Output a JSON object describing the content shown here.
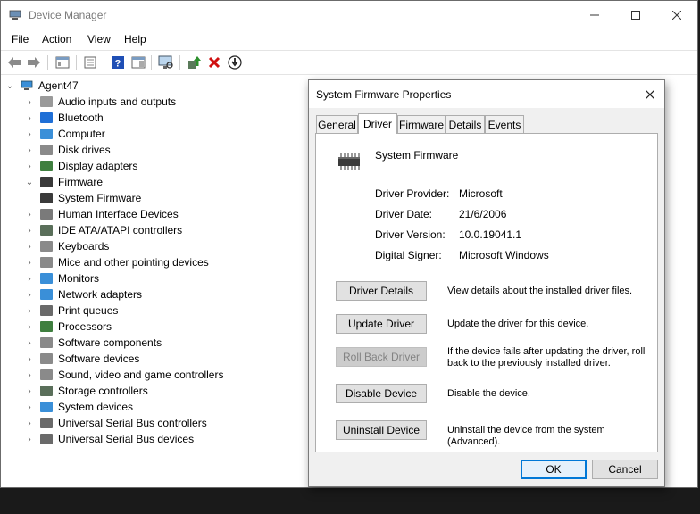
{
  "window": {
    "title": "Device Manager"
  },
  "menubar": {
    "items": [
      "File",
      "Action",
      "View",
      "Help"
    ]
  },
  "toolbar": {
    "icons": [
      "back-arrow-icon",
      "forward-arrow-icon",
      "show-hide-tree-icon",
      "properties-icon",
      "help-icon",
      "action-pane-icon",
      "scan-hardware-icon",
      "update-driver-icon",
      "uninstall-icon",
      "disable-device-icon"
    ]
  },
  "tree": {
    "root": "Agent47",
    "nodes": [
      {
        "label": "Audio inputs and outputs",
        "icon": "speaker-icon",
        "color": "#9a9a9a",
        "expanded": false
      },
      {
        "label": "Bluetooth",
        "icon": "bluetooth-icon",
        "color": "#1f6fd6",
        "expanded": false
      },
      {
        "label": "Computer",
        "icon": "computer-icon",
        "color": "#3a8fd8",
        "expanded": false
      },
      {
        "label": "Disk drives",
        "icon": "disk-drive-icon",
        "color": "#8a8a8a",
        "expanded": false
      },
      {
        "label": "Display adapters",
        "icon": "display-adapter-icon",
        "color": "#3f7f3f",
        "expanded": false
      },
      {
        "label": "Firmware",
        "icon": "firmware-chip-icon",
        "color": "#3a3a3a",
        "expanded": true
      },
      {
        "label": "System Firmware",
        "icon": "firmware-chip-icon",
        "color": "#3a3a3a",
        "child": true
      },
      {
        "label": "Human Interface Devices",
        "icon": "hid-icon",
        "color": "#7a7a7a",
        "expanded": false
      },
      {
        "label": "IDE ATA/ATAPI controllers",
        "icon": "ide-controller-icon",
        "color": "#5a6f5a",
        "expanded": false
      },
      {
        "label": "Keyboards",
        "icon": "keyboard-icon",
        "color": "#8a8a8a",
        "expanded": false
      },
      {
        "label": "Mice and other pointing devices",
        "icon": "mouse-icon",
        "color": "#8a8a8a",
        "expanded": false
      },
      {
        "label": "Monitors",
        "icon": "monitor-icon",
        "color": "#3a8fd8",
        "expanded": false
      },
      {
        "label": "Network adapters",
        "icon": "network-adapter-icon",
        "color": "#3a8fd8",
        "expanded": false
      },
      {
        "label": "Print queues",
        "icon": "printer-icon",
        "color": "#6a6a6a",
        "expanded": false
      },
      {
        "label": "Processors",
        "icon": "processor-icon",
        "color": "#3f7f3f",
        "expanded": false
      },
      {
        "label": "Software components",
        "icon": "software-component-icon",
        "color": "#8a8a8a",
        "expanded": false
      },
      {
        "label": "Software devices",
        "icon": "software-device-icon",
        "color": "#8a8a8a",
        "expanded": false
      },
      {
        "label": "Sound, video and game controllers",
        "icon": "sound-icon",
        "color": "#8a8a8a",
        "expanded": false
      },
      {
        "label": "Storage controllers",
        "icon": "storage-controller-icon",
        "color": "#5a6f5a",
        "expanded": false
      },
      {
        "label": "System devices",
        "icon": "system-device-icon",
        "color": "#3a8fd8",
        "expanded": false
      },
      {
        "label": "Universal Serial Bus controllers",
        "icon": "usb-icon",
        "color": "#6a6a6a",
        "expanded": false
      },
      {
        "label": "Universal Serial Bus devices",
        "icon": "usb-icon",
        "color": "#6a6a6a",
        "expanded": false
      }
    ]
  },
  "dialog": {
    "title": "System Firmware Properties",
    "tabs": [
      "General",
      "Driver",
      "Firmware",
      "Details",
      "Events"
    ],
    "active_tab": "Driver",
    "device_name": "System Firmware",
    "props": [
      {
        "label": "Driver Provider:",
        "value": "Microsoft"
      },
      {
        "label": "Driver Date:",
        "value": "21/6/2006"
      },
      {
        "label": "Driver Version:",
        "value": "10.0.19041.1"
      },
      {
        "label": "Digital Signer:",
        "value": "Microsoft Windows"
      }
    ],
    "actions": [
      {
        "button": "Driver Details",
        "desc": "View details about the installed driver files.",
        "enabled": true
      },
      {
        "button": "Update Driver",
        "desc": "Update the driver for this device.",
        "enabled": true
      },
      {
        "button": "Roll Back Driver",
        "desc": "If the device fails after updating the driver, roll back to the previously installed driver.",
        "enabled": false
      },
      {
        "button": "Disable Device",
        "desc": "Disable the device.",
        "enabled": true
      },
      {
        "button": "Uninstall Device",
        "desc": "Uninstall the device from the system (Advanced).",
        "enabled": true
      }
    ],
    "ok_label": "OK",
    "cancel_label": "Cancel"
  },
  "colors": {
    "accent": "#0078d7",
    "toolbar_help": "#1f4fb5",
    "toolbar_delete": "#d01010",
    "toolbar_update": "#2c8f2c"
  }
}
